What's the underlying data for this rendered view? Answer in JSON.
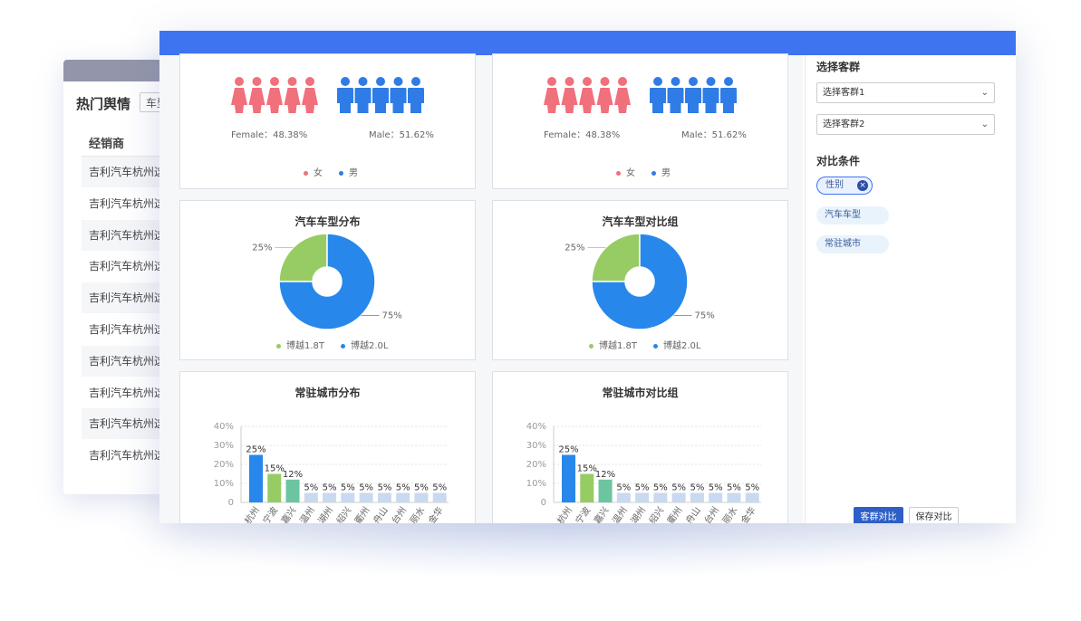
{
  "back_window": {
    "title": "热门舆情",
    "chip": "车型",
    "column_header": "经销商",
    "rows": [
      "吉利汽车杭州这",
      "吉利汽车杭州这",
      "吉利汽车杭州这",
      "吉利汽车杭州这",
      "吉利汽车杭州这",
      "吉利汽车杭州这",
      "吉利汽车杭州这",
      "吉利汽车杭州这",
      "吉利汽车杭州这",
      "吉利汽车杭州这"
    ]
  },
  "colors": {
    "female": "#f0707c",
    "male": "#2f7ce6",
    "pie_green": "#97cc64",
    "pie_blue": "#2887ea",
    "bar_blue": "#2887ea",
    "bar_green": "#97cc64",
    "bar_teal": "#6cc5a0",
    "bar_light": "#c9d9ef",
    "header_blue": "#3e74f0"
  },
  "gender": {
    "female_caption": "Female：48.38%",
    "male_caption": "Male：51.62%",
    "legend_female": "女",
    "legend_male": "男",
    "female_icon_count": 5,
    "male_icon_count": 5
  },
  "sidebar": {
    "select_group_title": "选择客群",
    "select1": "选择客群1",
    "select2": "选择客群2",
    "compare_title": "对比条件",
    "tags": [
      "性别",
      "汽车车型",
      "常驻城市"
    ],
    "btn_compare": "客群对比",
    "btn_save": "保存对比"
  },
  "chart_data": [
    {
      "type": "pie",
      "title": "汽车车型分布",
      "labels": [
        "博越1.8T",
        "博越2.0L"
      ],
      "values": [
        25,
        75
      ],
      "value_labels": [
        "25%",
        "75%"
      ]
    },
    {
      "type": "pie",
      "title": "汽车车型对比组",
      "labels": [
        "博越1.8T",
        "博越2.0L"
      ],
      "values": [
        25,
        75
      ],
      "value_labels": [
        "25%",
        "75%"
      ]
    },
    {
      "type": "bar",
      "title": "常驻城市分布",
      "categories": [
        "杭州",
        "宁波",
        "嘉兴",
        "温州",
        "湖州",
        "绍兴",
        "衢州",
        "舟山",
        "台州",
        "丽水",
        "金华"
      ],
      "values": [
        25,
        15,
        12,
        5,
        5,
        5,
        5,
        5,
        5,
        5,
        5
      ],
      "value_labels": [
        "25%",
        "15%",
        "12%",
        "5%",
        "5%",
        "5%",
        "5%",
        "5%",
        "5%",
        "5%",
        "5%"
      ],
      "yticks": [
        "0",
        "10%",
        "20%",
        "30%",
        "40%"
      ],
      "ylim": [
        0,
        40
      ]
    },
    {
      "type": "bar",
      "title": "常驻城市对比组",
      "categories": [
        "杭州",
        "宁波",
        "嘉兴",
        "温州",
        "湖州",
        "绍兴",
        "衢州",
        "舟山",
        "台州",
        "丽水",
        "金华"
      ],
      "values": [
        25,
        15,
        12,
        5,
        5,
        5,
        5,
        5,
        5,
        5,
        5
      ],
      "value_labels": [
        "25%",
        "15%",
        "12%",
        "5%",
        "5%",
        "5%",
        "5%",
        "5%",
        "5%",
        "5%",
        "5%"
      ],
      "yticks": [
        "0",
        "10%",
        "20%",
        "30%",
        "40%"
      ],
      "ylim": [
        0,
        40
      ]
    }
  ]
}
